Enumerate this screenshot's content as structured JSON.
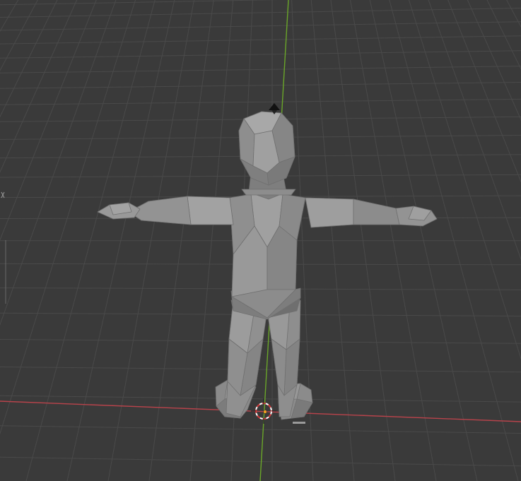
{
  "viewport": {
    "mode": "3d-viewport",
    "background": "#3a3a3a",
    "grid_color": "#4a4a4a",
    "x_axis_color": "#c0444c",
    "y_axis_color": "#6aa629",
    "mesh_color": "#8a8a8a"
  },
  "objects": {
    "mesh": {
      "name": "low-poly-humanoid"
    },
    "cursor": {
      "icon": "3d-cursor-icon"
    },
    "origin": {
      "icon": "origin-dot-icon"
    },
    "light": {
      "icon": "light-icon"
    }
  }
}
